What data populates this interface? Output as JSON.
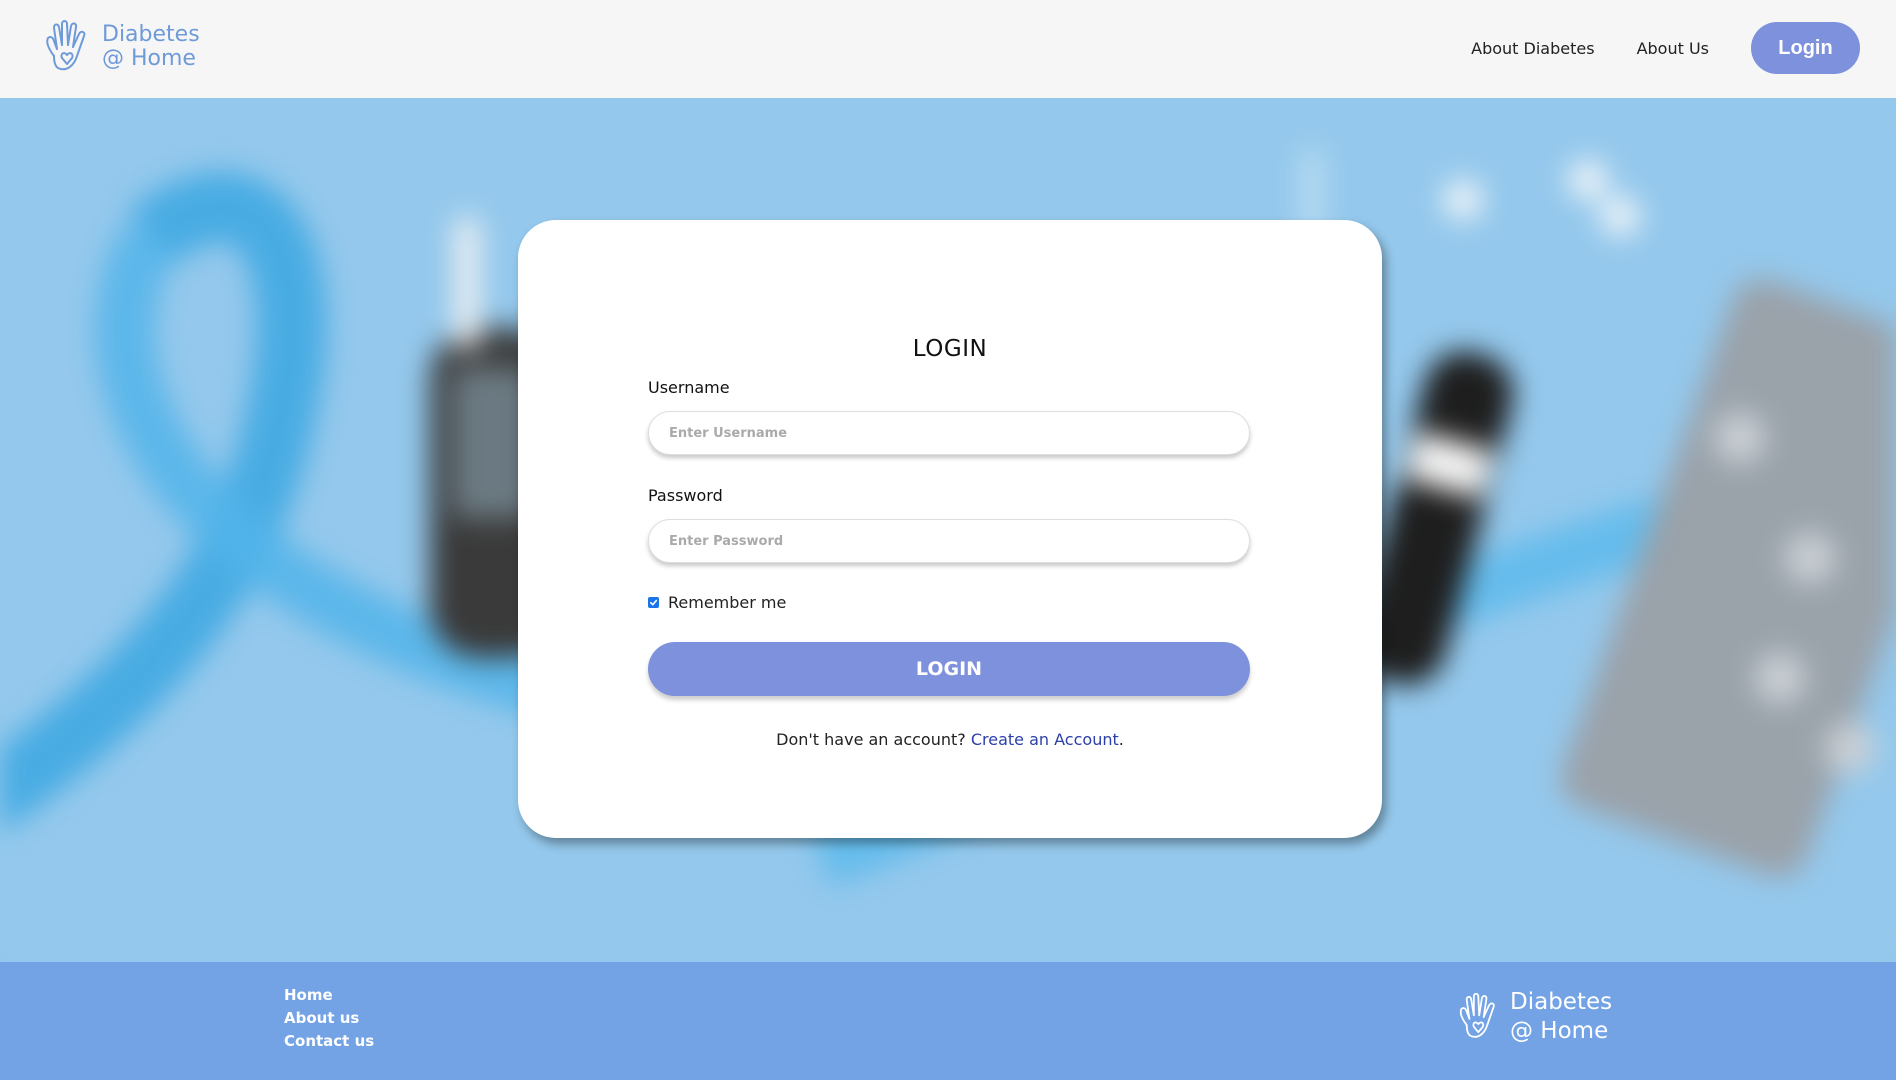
{
  "header": {
    "logo": {
      "line1": "Diabetes",
      "line2": "@ Home"
    },
    "nav": {
      "about_diabetes": "About Diabetes",
      "about_us": "About Us",
      "login": "Login"
    }
  },
  "login_form": {
    "title": "LOGIN",
    "username": {
      "label": "Username",
      "placeholder": "Enter Username",
      "value": ""
    },
    "password": {
      "label": "Password",
      "placeholder": "Enter Password",
      "value": ""
    },
    "remember_me": {
      "label": "Remember me",
      "checked": true
    },
    "submit_label": "LOGIN",
    "signup": {
      "prompt": "Don't have an account?",
      "link": "Create an Account",
      "suffix": "."
    }
  },
  "footer": {
    "links": [
      "Home",
      "About us",
      "Contact us"
    ],
    "logo": {
      "line1": "Diabetes",
      "line2": "@ Home"
    }
  },
  "colors": {
    "header_bg": "#f6f6f6",
    "accent": "#7e91dc",
    "hero_bg": "#94c8ec",
    "footer_bg": "#73a3e5",
    "link": "#2a3fa8",
    "logo": "#6f9ad8"
  },
  "icons": {
    "logo": "hand-heart-icon",
    "checkbox": "checkmark-icon"
  }
}
